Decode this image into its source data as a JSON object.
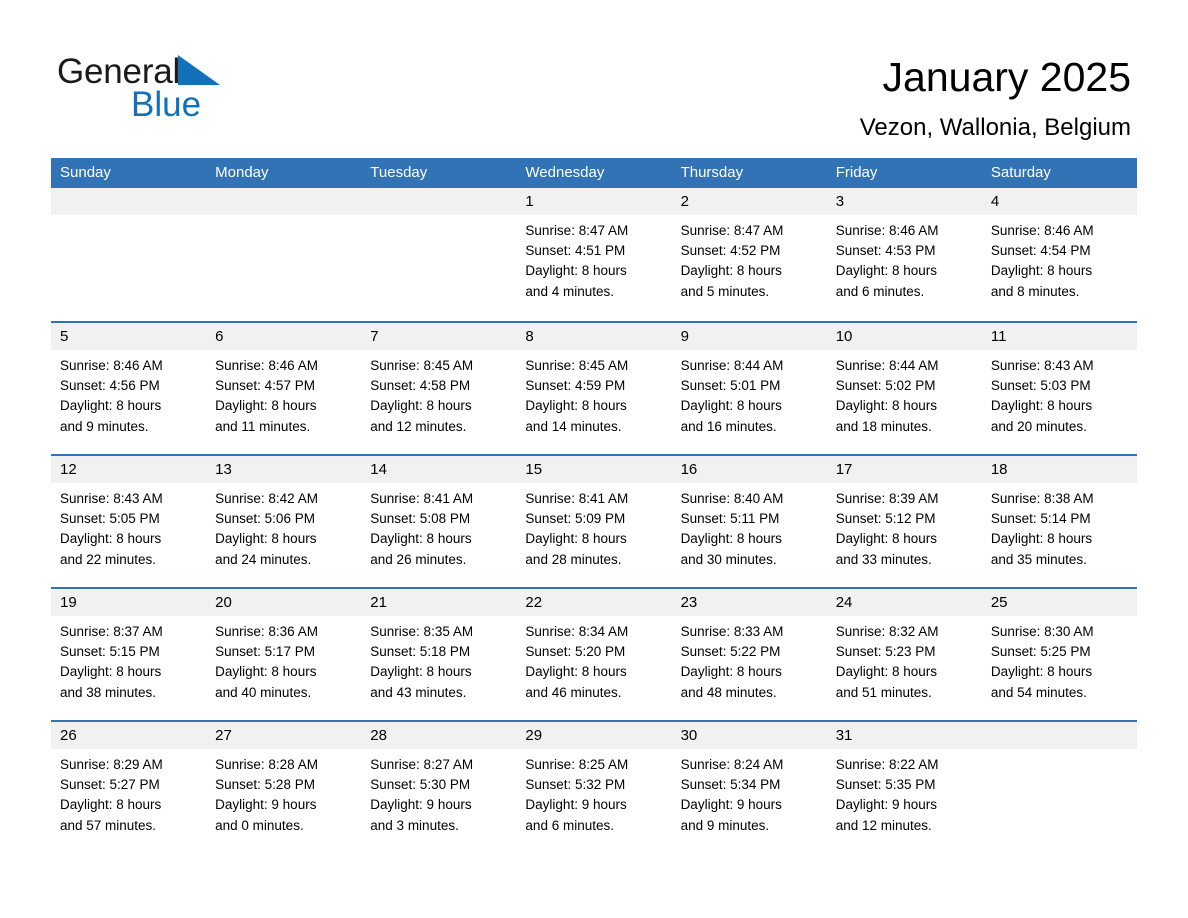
{
  "brand": {
    "name_part1": "General",
    "name_part2": "Blue"
  },
  "header": {
    "title": "January 2025",
    "location": "Vezon, Wallonia, Belgium"
  },
  "calendar": {
    "weekdays": [
      "Sunday",
      "Monday",
      "Tuesday",
      "Wednesday",
      "Thursday",
      "Friday",
      "Saturday"
    ],
    "accent_color": "#3273b5",
    "day_band_color": "#f1f1f1",
    "weeks": [
      [
        {
          "day": "",
          "sunrise": "",
          "sunset": "",
          "daylight_line1": "",
          "daylight_line2": ""
        },
        {
          "day": "",
          "sunrise": "",
          "sunset": "",
          "daylight_line1": "",
          "daylight_line2": ""
        },
        {
          "day": "",
          "sunrise": "",
          "sunset": "",
          "daylight_line1": "",
          "daylight_line2": ""
        },
        {
          "day": "1",
          "sunrise": "Sunrise: 8:47 AM",
          "sunset": "Sunset: 4:51 PM",
          "daylight_line1": "Daylight: 8 hours",
          "daylight_line2": "and 4 minutes."
        },
        {
          "day": "2",
          "sunrise": "Sunrise: 8:47 AM",
          "sunset": "Sunset: 4:52 PM",
          "daylight_line1": "Daylight: 8 hours",
          "daylight_line2": "and 5 minutes."
        },
        {
          "day": "3",
          "sunrise": "Sunrise: 8:46 AM",
          "sunset": "Sunset: 4:53 PM",
          "daylight_line1": "Daylight: 8 hours",
          "daylight_line2": "and 6 minutes."
        },
        {
          "day": "4",
          "sunrise": "Sunrise: 8:46 AM",
          "sunset": "Sunset: 4:54 PM",
          "daylight_line1": "Daylight: 8 hours",
          "daylight_line2": "and 8 minutes."
        }
      ],
      [
        {
          "day": "5",
          "sunrise": "Sunrise: 8:46 AM",
          "sunset": "Sunset: 4:56 PM",
          "daylight_line1": "Daylight: 8 hours",
          "daylight_line2": "and 9 minutes."
        },
        {
          "day": "6",
          "sunrise": "Sunrise: 8:46 AM",
          "sunset": "Sunset: 4:57 PM",
          "daylight_line1": "Daylight: 8 hours",
          "daylight_line2": "and 11 minutes."
        },
        {
          "day": "7",
          "sunrise": "Sunrise: 8:45 AM",
          "sunset": "Sunset: 4:58 PM",
          "daylight_line1": "Daylight: 8 hours",
          "daylight_line2": "and 12 minutes."
        },
        {
          "day": "8",
          "sunrise": "Sunrise: 8:45 AM",
          "sunset": "Sunset: 4:59 PM",
          "daylight_line1": "Daylight: 8 hours",
          "daylight_line2": "and 14 minutes."
        },
        {
          "day": "9",
          "sunrise": "Sunrise: 8:44 AM",
          "sunset": "Sunset: 5:01 PM",
          "daylight_line1": "Daylight: 8 hours",
          "daylight_line2": "and 16 minutes."
        },
        {
          "day": "10",
          "sunrise": "Sunrise: 8:44 AM",
          "sunset": "Sunset: 5:02 PM",
          "daylight_line1": "Daylight: 8 hours",
          "daylight_line2": "and 18 minutes."
        },
        {
          "day": "11",
          "sunrise": "Sunrise: 8:43 AM",
          "sunset": "Sunset: 5:03 PM",
          "daylight_line1": "Daylight: 8 hours",
          "daylight_line2": "and 20 minutes."
        }
      ],
      [
        {
          "day": "12",
          "sunrise": "Sunrise: 8:43 AM",
          "sunset": "Sunset: 5:05 PM",
          "daylight_line1": "Daylight: 8 hours",
          "daylight_line2": "and 22 minutes."
        },
        {
          "day": "13",
          "sunrise": "Sunrise: 8:42 AM",
          "sunset": "Sunset: 5:06 PM",
          "daylight_line1": "Daylight: 8 hours",
          "daylight_line2": "and 24 minutes."
        },
        {
          "day": "14",
          "sunrise": "Sunrise: 8:41 AM",
          "sunset": "Sunset: 5:08 PM",
          "daylight_line1": "Daylight: 8 hours",
          "daylight_line2": "and 26 minutes."
        },
        {
          "day": "15",
          "sunrise": "Sunrise: 8:41 AM",
          "sunset": "Sunset: 5:09 PM",
          "daylight_line1": "Daylight: 8 hours",
          "daylight_line2": "and 28 minutes."
        },
        {
          "day": "16",
          "sunrise": "Sunrise: 8:40 AM",
          "sunset": "Sunset: 5:11 PM",
          "daylight_line1": "Daylight: 8 hours",
          "daylight_line2": "and 30 minutes."
        },
        {
          "day": "17",
          "sunrise": "Sunrise: 8:39 AM",
          "sunset": "Sunset: 5:12 PM",
          "daylight_line1": "Daylight: 8 hours",
          "daylight_line2": "and 33 minutes."
        },
        {
          "day": "18",
          "sunrise": "Sunrise: 8:38 AM",
          "sunset": "Sunset: 5:14 PM",
          "daylight_line1": "Daylight: 8 hours",
          "daylight_line2": "and 35 minutes."
        }
      ],
      [
        {
          "day": "19",
          "sunrise": "Sunrise: 8:37 AM",
          "sunset": "Sunset: 5:15 PM",
          "daylight_line1": "Daylight: 8 hours",
          "daylight_line2": "and 38 minutes."
        },
        {
          "day": "20",
          "sunrise": "Sunrise: 8:36 AM",
          "sunset": "Sunset: 5:17 PM",
          "daylight_line1": "Daylight: 8 hours",
          "daylight_line2": "and 40 minutes."
        },
        {
          "day": "21",
          "sunrise": "Sunrise: 8:35 AM",
          "sunset": "Sunset: 5:18 PM",
          "daylight_line1": "Daylight: 8 hours",
          "daylight_line2": "and 43 minutes."
        },
        {
          "day": "22",
          "sunrise": "Sunrise: 8:34 AM",
          "sunset": "Sunset: 5:20 PM",
          "daylight_line1": "Daylight: 8 hours",
          "daylight_line2": "and 46 minutes."
        },
        {
          "day": "23",
          "sunrise": "Sunrise: 8:33 AM",
          "sunset": "Sunset: 5:22 PM",
          "daylight_line1": "Daylight: 8 hours",
          "daylight_line2": "and 48 minutes."
        },
        {
          "day": "24",
          "sunrise": "Sunrise: 8:32 AM",
          "sunset": "Sunset: 5:23 PM",
          "daylight_line1": "Daylight: 8 hours",
          "daylight_line2": "and 51 minutes."
        },
        {
          "day": "25",
          "sunrise": "Sunrise: 8:30 AM",
          "sunset": "Sunset: 5:25 PM",
          "daylight_line1": "Daylight: 8 hours",
          "daylight_line2": "and 54 minutes."
        }
      ],
      [
        {
          "day": "26",
          "sunrise": "Sunrise: 8:29 AM",
          "sunset": "Sunset: 5:27 PM",
          "daylight_line1": "Daylight: 8 hours",
          "daylight_line2": "and 57 minutes."
        },
        {
          "day": "27",
          "sunrise": "Sunrise: 8:28 AM",
          "sunset": "Sunset: 5:28 PM",
          "daylight_line1": "Daylight: 9 hours",
          "daylight_line2": "and 0 minutes."
        },
        {
          "day": "28",
          "sunrise": "Sunrise: 8:27 AM",
          "sunset": "Sunset: 5:30 PM",
          "daylight_line1": "Daylight: 9 hours",
          "daylight_line2": "and 3 minutes."
        },
        {
          "day": "29",
          "sunrise": "Sunrise: 8:25 AM",
          "sunset": "Sunset: 5:32 PM",
          "daylight_line1": "Daylight: 9 hours",
          "daylight_line2": "and 6 minutes."
        },
        {
          "day": "30",
          "sunrise": "Sunrise: 8:24 AM",
          "sunset": "Sunset: 5:34 PM",
          "daylight_line1": "Daylight: 9 hours",
          "daylight_line2": "and 9 minutes."
        },
        {
          "day": "31",
          "sunrise": "Sunrise: 8:22 AM",
          "sunset": "Sunset: 5:35 PM",
          "daylight_line1": "Daylight: 9 hours",
          "daylight_line2": "and 12 minutes."
        },
        {
          "day": "",
          "sunrise": "",
          "sunset": "",
          "daylight_line1": "",
          "daylight_line2": ""
        }
      ]
    ]
  }
}
